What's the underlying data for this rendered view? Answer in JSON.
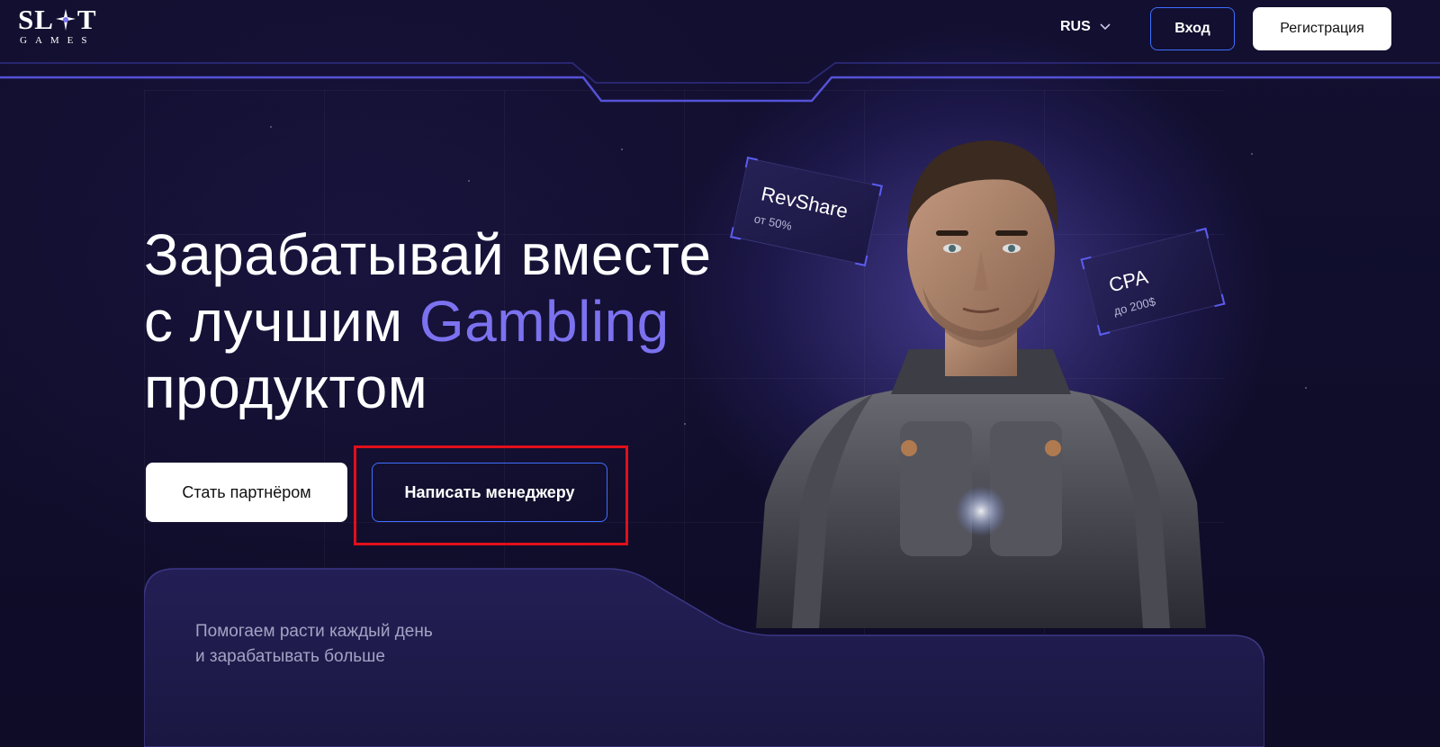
{
  "header": {
    "logo": {
      "word": "SL T",
      "sub": "GAMES"
    },
    "language": "RUS",
    "login_label": "Вход",
    "register_label": "Регистрация"
  },
  "hero": {
    "title_line1": "Зарабатывай вместе",
    "title_line2_prefix": "с лучшим ",
    "title_line2_accent": "Gambling",
    "title_line3": "продуктом",
    "partner_button": "Стать партнёром",
    "manager_button": "Написать менеджеру"
  },
  "cards": [
    {
      "title": "RevShare",
      "subtitle": "от 50%"
    },
    {
      "title": "CPA",
      "subtitle": "до 200$"
    }
  ],
  "panel": {
    "line1": "Помогаем расти каждый день",
    "line2": "и зарабатывать больше"
  },
  "colors": {
    "background": "#0e0c27",
    "accent": "#7c72f0",
    "outline_blue": "#3f6fff",
    "highlight_red": "#e10f1a"
  }
}
